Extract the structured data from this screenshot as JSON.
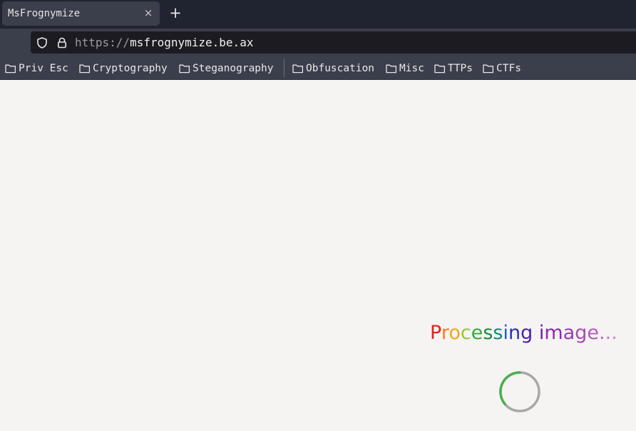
{
  "browser": {
    "tab": {
      "title": "MsFrognymize",
      "close_glyph": "×"
    },
    "new_tab_glyph": "+",
    "url": {
      "scheme": "https://",
      "host": "msfrognymize.be.ax"
    }
  },
  "bookmarks": [
    {
      "label": "Priv Esc",
      "icon": "folder-icon"
    },
    {
      "label": "Cryptography",
      "icon": "folder-icon"
    },
    {
      "label": "Steganography",
      "icon": "folder-icon"
    },
    {
      "label": "Obfuscation",
      "icon": "folder-icon"
    },
    {
      "label": "Misc",
      "icon": "folder-icon"
    },
    {
      "label": "TTPs",
      "icon": "folder-icon"
    },
    {
      "label": "CTFs",
      "icon": "folder-icon"
    }
  ],
  "page": {
    "status_text": "Processing image...",
    "status_colors": [
      "#e8211c",
      "#f57c1f",
      "#f1a81a",
      "#9bc43a",
      "#37a83a",
      "#1a8a3c",
      "#0e8a78",
      "#1e5fb8",
      "#2a2fb0",
      "#4b22a8",
      "#6b1fa6",
      "#8e2aa8",
      "#9a3bb0",
      "#a84ab6",
      "#b35abb",
      "#bd69c0",
      "#c678c4",
      "#cf87c8",
      "#d896cc"
    ],
    "spinner": {
      "icon": "loading-spinner-icon",
      "track_color": "#a8a8a8",
      "accent_color": "#4caf50"
    }
  }
}
